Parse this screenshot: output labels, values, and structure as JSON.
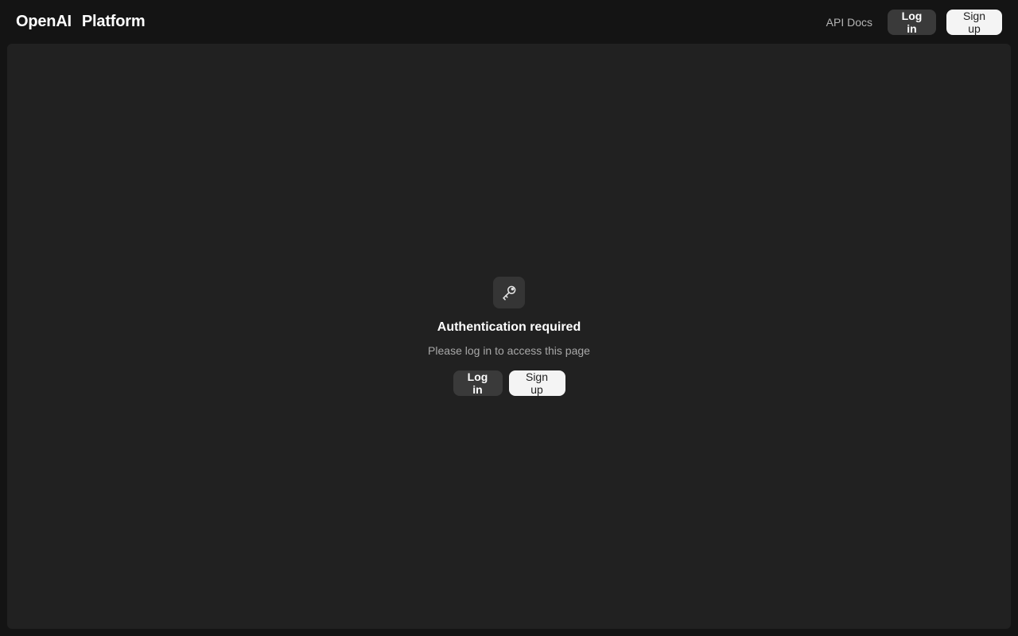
{
  "header": {
    "brand_name": "OpenAI",
    "brand_product": "Platform",
    "api_docs_label": "API Docs",
    "login_label": "Log in",
    "signup_label": "Sign up"
  },
  "auth": {
    "icon": "key-icon",
    "title": "Authentication required",
    "subtitle": "Please log in to access this page",
    "login_label": "Log in",
    "signup_label": "Sign up"
  },
  "colors": {
    "background": "#141414",
    "panel": "#212121",
    "button_dark": "#3a3a3a",
    "button_light": "#f4f4f4",
    "muted_text": "#a8a8a8"
  }
}
